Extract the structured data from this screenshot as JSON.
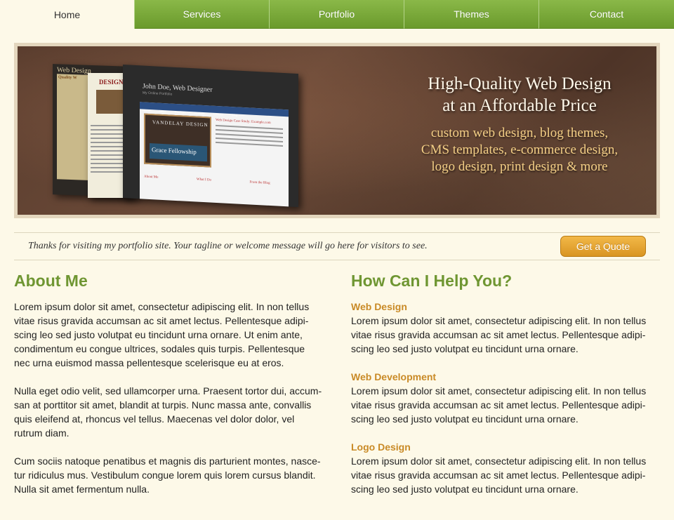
{
  "nav": {
    "items": [
      {
        "label": "Home",
        "active": true
      },
      {
        "label": "Services",
        "active": false
      },
      {
        "label": "Portfolio",
        "active": false
      },
      {
        "label": "Themes",
        "active": false
      },
      {
        "label": "Contact",
        "active": false
      }
    ]
  },
  "hero": {
    "title_line1": "High-Quality Web Design",
    "title_line2": "at an Affordable Price",
    "sub_line1": "custom web design, blog themes,",
    "sub_line2": "CMS templates, e-commerce design,",
    "sub_line3": "logo design, print design & more",
    "shots": {
      "shot1_title": "Web Design",
      "shot1_tagline": "Quality W",
      "shot2_title": "DESIGN",
      "shot3_header": "John Doe, Web Designer",
      "shot3_sub": "My Online Portfolio",
      "shot3_nav": [
        "Home",
        "About",
        "Services",
        "Portfolio",
        "Contact",
        "Blog"
      ],
      "shot3_feature": "VANDELAY DESIGN",
      "shot3_caption": "Grace Fellowship",
      "shot3_side_title": "Web Design Case Study: Example.com",
      "shot3_col1": "About Me",
      "shot3_col2": "What I Do",
      "shot3_col3": "From the Blog"
    }
  },
  "tagline": {
    "text": "Thanks for visiting my portfolio site. Your tagline or welcome message will go here for visitors to see.",
    "button_label": "Get a Quote"
  },
  "about": {
    "heading": "About Me",
    "paragraphs": [
      "Lorem ipsum dolor sit amet, consectetur adipiscing elit. In non tellus vitae risus gravida accumsan ac sit amet lectus. Pellentesque adipi-scing leo sed justo volutpat eu tincidunt urna ornare. Ut enim ante, condimentum eu congue ultrices, sodales quis turpis. Pellentesque nec urna euismod massa pellentesque scelerisque eu at eros.",
      "Nulla eget odio velit, sed ullamcorper urna. Praesent tortor dui, accum-san at porttitor sit amet, blandit at turpis. Nunc massa ante, convallis quis eleifend at, rhoncus vel tellus. Maecenas vel dolor dolor, vel rutrum diam.",
      "Cum sociis natoque penatibus et magnis dis parturient montes, nasce-tur ridiculus mus. Vestibulum congue lorem quis lorem cursus blandit. Nulla sit amet fermentum nulla."
    ]
  },
  "help": {
    "heading": "How Can I Help You?",
    "services": [
      {
        "title": "Web Design",
        "text": "Lorem ipsum dolor sit amet, consectetur adipiscing elit. In non tellus vitae risus gravida accumsan ac sit amet lectus. Pellentesque adipi-scing leo sed justo volutpat eu tincidunt urna ornare."
      },
      {
        "title": "Web Development",
        "text": "Lorem ipsum dolor sit amet, consectetur adipiscing elit. In non tellus vitae risus gravida accumsan ac sit amet lectus. Pellentesque adipi-scing leo sed justo volutpat eu tincidunt urna ornare."
      },
      {
        "title": "Logo Design",
        "text": "Lorem ipsum dolor sit amet, consectetur adipiscing elit. In non tellus vitae risus gravida accumsan ac sit amet lectus. Pellentesque adipi-scing leo sed justo volutpat eu tincidunt urna ornare."
      }
    ]
  },
  "colors": {
    "nav_green": "#7aa83a",
    "heading_green": "#6f9632",
    "service_orange": "#c98a26",
    "button_orange": "#e5a433",
    "page_bg": "#fdf9e8"
  }
}
